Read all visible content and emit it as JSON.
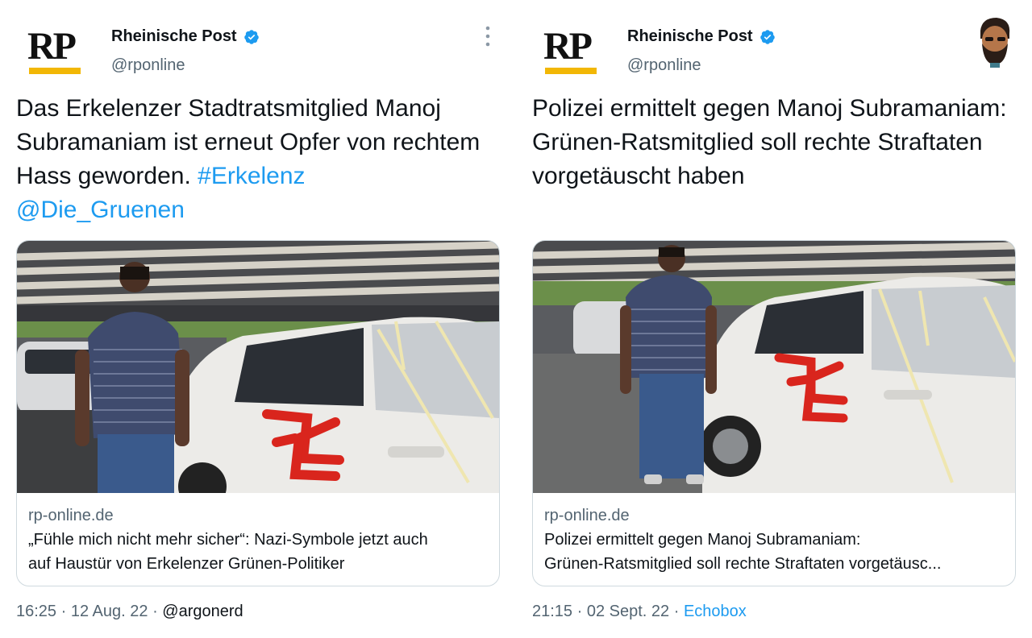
{
  "tweets": [
    {
      "name": "Rheinische Post",
      "handle": "@rponline",
      "logo_text": "RP",
      "text_plain": "Das Erkelenzer Stadtratsmitglied Manoj Subramaniam ist erneut Opfer von rechtem Hass geworden.",
      "hashtag": "#Erkelenz",
      "mention": "@Die_Gruenen",
      "card": {
        "domain": "rp-online.de",
        "title_line1": "„Fühle mich nicht mehr sicher“: Nazi-Symbole jetzt auch",
        "title_line2": "auf Haustür von Erkelenzer Grünen-Politiker"
      },
      "time": "16:25",
      "date": "12 Aug. 22",
      "watermark": "@argonerd"
    },
    {
      "name": "Rheinische Post",
      "handle": "@rponline",
      "logo_text": "RP",
      "text_plain": "Polizei ermittelt gegen Manoj Subramaniam: Grünen-Ratsmitglied soll rechte Straftaten vorgetäuscht haben",
      "card": {
        "domain": "rp-online.de",
        "title_line1": "Polizei ermittelt gegen Manoj Subramaniam:",
        "title_line2": "Grünen-Ratsmitglied soll rechte Straftaten vorgetäusc..."
      },
      "time": "21:15",
      "date": "02 Sept. 22",
      "source": "Echobox"
    }
  ],
  "colors": {
    "link": "#1d9bf0",
    "secondary": "#536471",
    "verified": "#1d9bf0",
    "logo_bar": "#f2b705",
    "swastika_paint": "#d9251d"
  },
  "icons": [
    "verified-badge-icon",
    "more-options-icon"
  ]
}
